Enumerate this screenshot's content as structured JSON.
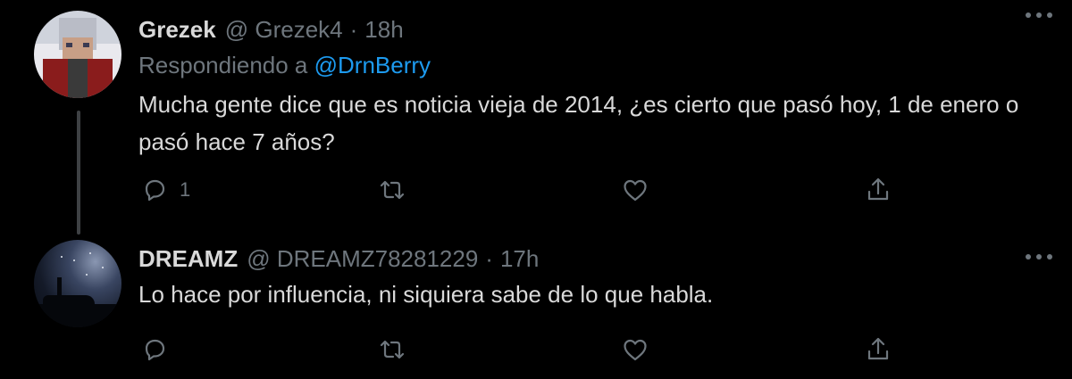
{
  "replies": [
    {
      "name": "Grezek",
      "handle": "@ Grezek4",
      "dot": "·",
      "time": "18h",
      "replying_prefix": "Respondiendo a ",
      "replying_to": "@DrnBerry",
      "text": "Mucha gente dice que es noticia vieja de 2014, ¿es cierto que pasó hoy, 1 de enero o pasó hace 7 años?",
      "reply_count": "1",
      "icons": {
        "reply": "reply-icon",
        "retweet": "retweet-icon",
        "like": "heart-icon",
        "share": "share-icon",
        "more": "more-icon"
      }
    },
    {
      "name": "DREAMZ",
      "handle": "@ DREAMZ78281229",
      "dot": "·",
      "time": "17h",
      "text": "Lo hace por influencia, ni siquiera sabe de lo que habla.",
      "reply_count": "",
      "icons": {
        "reply": "reply-icon",
        "retweet": "retweet-icon",
        "like": "heart-icon",
        "share": "share-icon",
        "more": "more-icon"
      }
    }
  ],
  "colors": {
    "background": "#000000",
    "text": "#d9d9d9",
    "muted": "#6e767d",
    "accent": "#1d9bf0"
  }
}
